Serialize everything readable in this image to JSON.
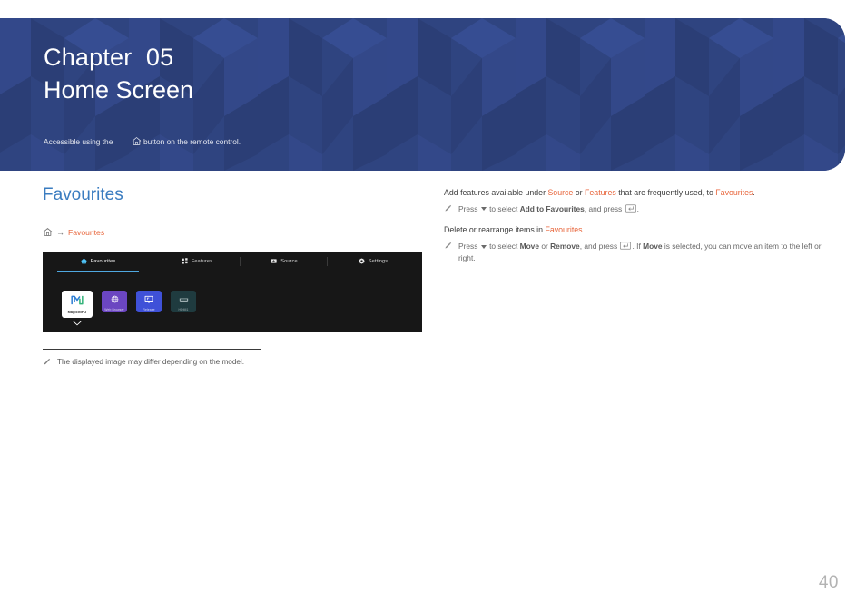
{
  "header": {
    "chapter_label": "Chapter  05",
    "title": "Home Screen",
    "note_before": "Accessible using the",
    "note_after": "button on the remote control.",
    "home_icon": "house-icon",
    "background_color": "#2f4480"
  },
  "left": {
    "section_title": "Favourites",
    "breadcrumb": {
      "home_icon": "house-icon",
      "arrow": "→",
      "item": "Favourites",
      "color": "#e8663c"
    },
    "mockup": {
      "background_color": "#171717",
      "accent_color": "#4fa8e0",
      "tabs": [
        {
          "label": "Favourites",
          "icon": "home-pentagon-icon",
          "active": true
        },
        {
          "label": "Features",
          "icon": "grid-squares-icon",
          "active": false
        },
        {
          "label": "Source",
          "icon": "source-input-icon",
          "active": false
        },
        {
          "label": "Settings",
          "icon": "gear-icon",
          "active": false
        }
      ],
      "tiles": [
        {
          "label": "MagicINFO",
          "icon": "magicinfo-logo-icon",
          "style": "selected",
          "selected": true
        },
        {
          "label": "Web Browser",
          "icon": "globe-icon",
          "style": "purple",
          "selected": false
        },
        {
          "label": "Release",
          "icon": "monitor-icon",
          "style": "blue",
          "selected": false
        },
        {
          "label": "HDMI1",
          "icon": "hdmi-port-icon",
          "style": "teal",
          "selected": false
        }
      ],
      "expand_icon": "chevron-down-icon"
    },
    "footnote": {
      "icon": "pencil-icon",
      "text": "The displayed image may differ depending on the model."
    }
  },
  "right": {
    "paragraph1": {
      "p1": "Add features available under ",
      "link1": "Source",
      "p2": " or ",
      "link2": "Features",
      "p3": " that are frequently used, to ",
      "link3": "Favourites",
      "p4": "."
    },
    "bullet1": {
      "icon": "pencil-icon",
      "b1": "Press ",
      "caret": "caret-down-icon",
      "b2": " to select ",
      "strong1": "Add to Favourites",
      "b3": ", and press ",
      "enter": "enter-key-icon",
      "b4": "."
    },
    "paragraph2": {
      "p1": "Delete or rearrange items in ",
      "link1": "Favourites",
      "p2": "."
    },
    "bullet2": {
      "icon": "pencil-icon",
      "b1": "Press ",
      "caret": "caret-down-icon",
      "b2": " to select ",
      "strong1": "Move",
      "b3": " or ",
      "strong2": "Remove",
      "b4": ", and press ",
      "enter": "enter-key-icon",
      "b5": ". If ",
      "strong3": "Move",
      "b6": " is selected, you can move an item to the left or right."
    }
  },
  "footer": {
    "page_number": "40"
  }
}
